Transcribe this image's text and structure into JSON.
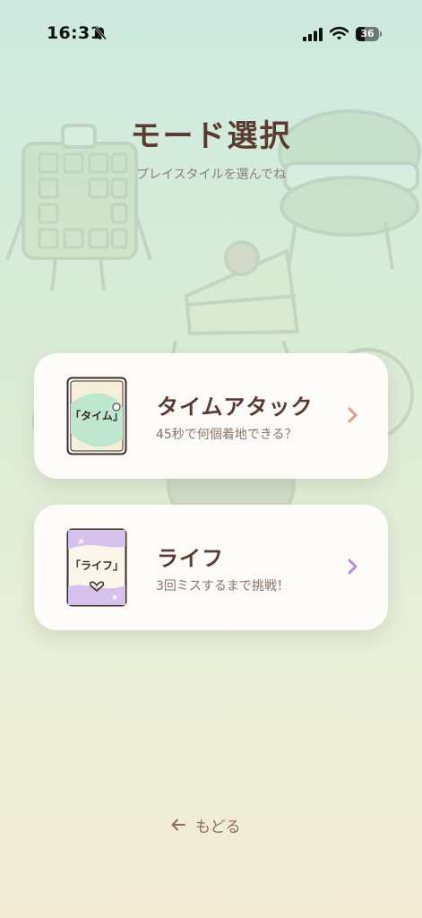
{
  "status_bar": {
    "time": "16:31",
    "battery": "36",
    "icons": [
      "bell-slash-icon",
      "signal-icon",
      "wifi-icon",
      "battery-icon"
    ]
  },
  "header": {
    "title": "モード選択",
    "subtitle": "プレイスタイルを選んでね"
  },
  "modes": [
    {
      "title": "タイムアタック",
      "description": "45秒で何個着地できる？",
      "thumb_label": "「タイム」",
      "accent": "#e89a86",
      "icon": "chevron-right-icon"
    },
    {
      "title": "ライフ",
      "description": "3回ミスするまで挑戦！",
      "thumb_label": "「ライフ」",
      "accent": "#b98bd9",
      "icon": "chevron-right-icon"
    }
  ],
  "footer": {
    "back_label": "もどる",
    "back_icon": "arrow-left-icon"
  },
  "colors": {
    "title": "#5b3b30",
    "subtitle": "#8f7d74",
    "background_top": "#cdeae0",
    "background_bottom": "#f2ecd5"
  }
}
